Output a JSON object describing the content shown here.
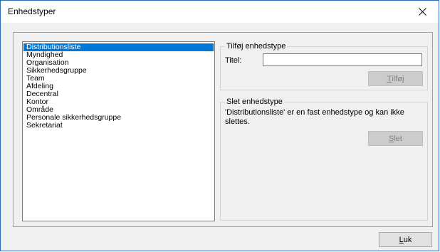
{
  "window": {
    "title": "Enhedstyper"
  },
  "list": {
    "items": [
      "Distributionsliste",
      "Myndighed",
      "Organisation",
      "Sikkerhedsgruppe",
      "Team",
      "Afdeling",
      "Decentral",
      "Kontor",
      "Område",
      "Personale sikkerhedsgruppe",
      "Sekretariat"
    ],
    "selected": "Distributionsliste"
  },
  "add_group": {
    "title": "Tilføj enhedstype",
    "field_label": "Titel:",
    "field_value": "",
    "button_mnemonic": "T",
    "button_rest": "ilføj",
    "button_enabled": false
  },
  "delete_group": {
    "title": "Slet enhedstype",
    "message": "'Distributionsliste' er en fast enhedstype og kan ikke slettes.",
    "button_mnemonic": "S",
    "button_rest": "let",
    "button_enabled": false
  },
  "footer": {
    "close_mnemonic": "L",
    "close_rest": "uk"
  },
  "colors": {
    "selection": "#0078d7",
    "window_border": "#2b6fb8",
    "dialog_bg": "#f0f0f0"
  },
  "icons": {
    "close": "close-icon"
  }
}
